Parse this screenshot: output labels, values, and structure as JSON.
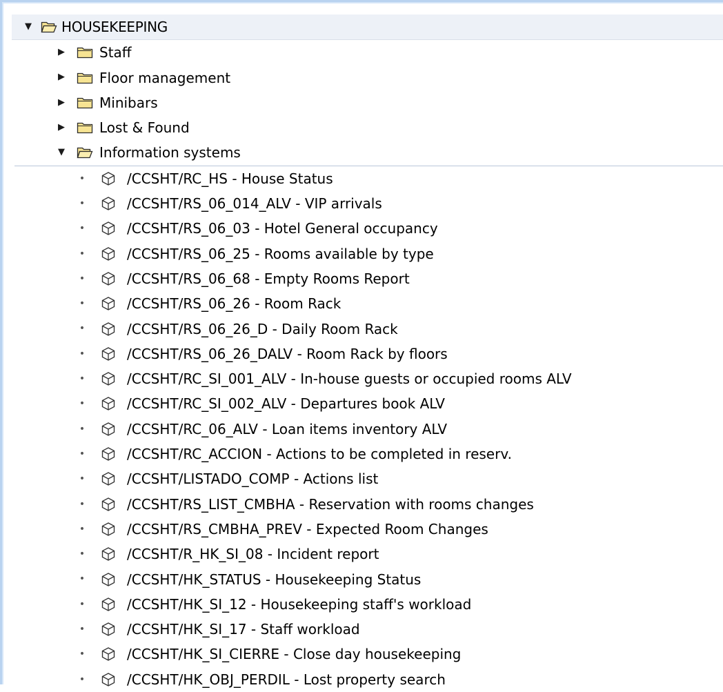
{
  "root": {
    "label": "HOUSEKEEPING",
    "expanded": true
  },
  "folders": [
    {
      "label": "Staff",
      "expanded": false
    },
    {
      "label": "Floor management",
      "expanded": false
    },
    {
      "label": "Minibars",
      "expanded": false
    },
    {
      "label": "Lost & Found",
      "expanded": false
    },
    {
      "label": "Information systems",
      "expanded": true
    }
  ],
  "transactions": [
    {
      "label": "/CCSHT/RC_HS - House Status"
    },
    {
      "label": "/CCSHT/RS_06_014_ALV - VIP arrivals"
    },
    {
      "label": "/CCSHT/RS_06_03 - Hotel General occupancy"
    },
    {
      "label": "/CCSHT/RS_06_25 - Rooms available by type"
    },
    {
      "label": "/CCSHT/RS_06_68 - Empty Rooms Report"
    },
    {
      "label": "/CCSHT/RS_06_26 - Room Rack"
    },
    {
      "label": "/CCSHT/RS_06_26_D - Daily Room Rack"
    },
    {
      "label": "/CCSHT/RS_06_26_DALV - Room Rack by floors"
    },
    {
      "label": "/CCSHT/RC_SI_001_ALV - In-house guests or occupied rooms ALV"
    },
    {
      "label": "/CCSHT/RC_SI_002_ALV - Departures book ALV"
    },
    {
      "label": "/CCSHT/RC_06_ALV - Loan items inventory ALV"
    },
    {
      "label": "/CCSHT/RC_ACCION - Actions to be completed in reserv."
    },
    {
      "label": "/CCSHT/LISTADO_COMP - Actions list"
    },
    {
      "label": "/CCSHT/RS_LIST_CMBHA - Reservation with rooms changes"
    },
    {
      "label": "/CCSHT/RS_CMBHA_PREV - Expected Room Changes"
    },
    {
      "label": "/CCSHT/R_HK_SI_08 - Incident report"
    },
    {
      "label": "/CCSHT/HK_STATUS - Housekeeping Status"
    },
    {
      "label": "/CCSHT/HK_SI_12 - Housekeeping staff's workload"
    },
    {
      "label": "/CCSHT/HK_SI_17 - Staff workload"
    },
    {
      "label": "/CCSHT/HK_SI_CIERRE - Close day housekeeping"
    },
    {
      "label": "/CCSHT/HK_OBJ_PERDIL - Lost property search"
    }
  ],
  "icons": {
    "collapsed": "triangle-right-icon",
    "expanded": "triangle-down-icon",
    "folder_closed": "folder-icon",
    "folder_open": "folder-open-icon",
    "transaction": "transaction-cube-icon",
    "bullet": "bullet-icon"
  },
  "colors": {
    "folder_fill": "#f7e493",
    "folder_stroke": "#2b2b2b",
    "root_row_bg": "#edf1f7",
    "frame_border": "#b9d3f0"
  }
}
